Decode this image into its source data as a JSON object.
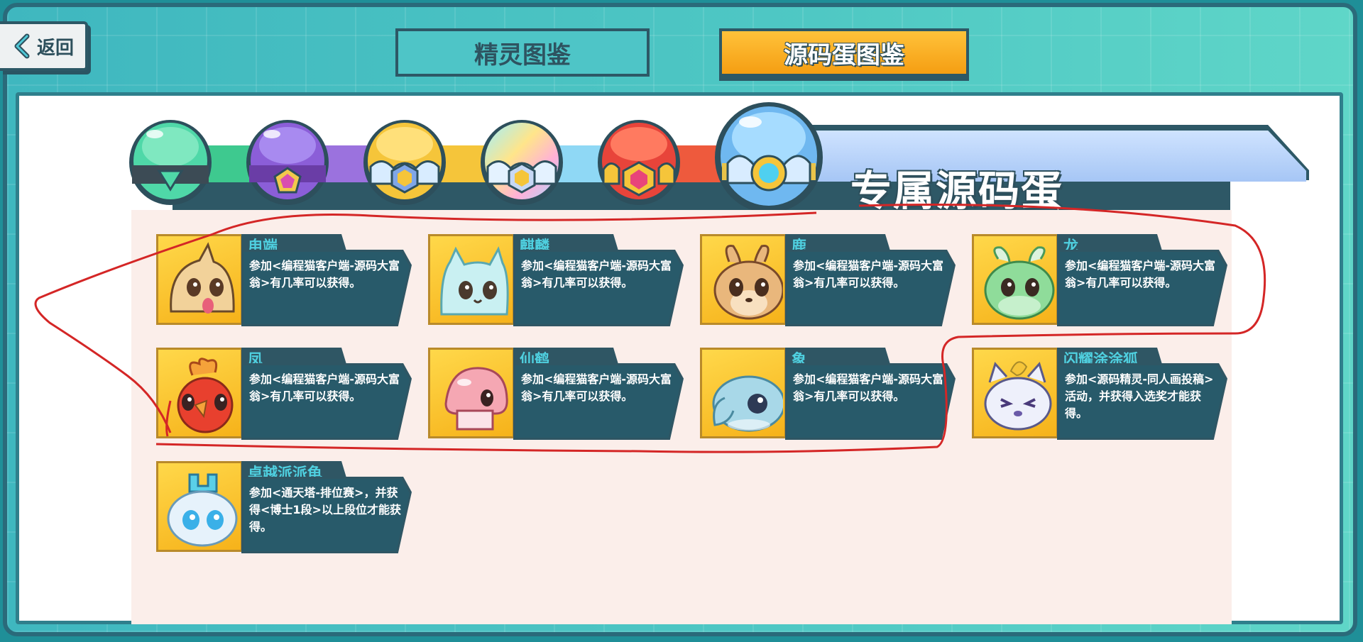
{
  "back_button": {
    "label": "返回"
  },
  "tabs": [
    {
      "label": "精灵图鉴",
      "active": false
    },
    {
      "label": "源码蛋图鉴",
      "active": true
    }
  ],
  "egg_track": {
    "title": "专属源码蛋",
    "eggs": [
      {
        "name": "green-egg",
        "color": "#3ec98f"
      },
      {
        "name": "purple-egg",
        "color": "#8b5ed8"
      },
      {
        "name": "gold-egg",
        "color": "#f5c53a"
      },
      {
        "name": "rainbow-egg",
        "color": "#8fd3ff"
      },
      {
        "name": "red-egg",
        "color": "#e8443a"
      },
      {
        "name": "exclusive-blue-egg",
        "color": "#6fb8f0",
        "selected": true
      }
    ]
  },
  "cards": [
    {
      "name": "甪端",
      "desc": "参加<编程猫客户端-源码大富翁>有几率可以获得。",
      "icon": "luduan-creature-icon",
      "color": "#f2d29a"
    },
    {
      "name": "麒麟",
      "desc": "参加<编程猫客户端-源码大富翁>有几率可以获得。",
      "icon": "qilin-creature-icon",
      "color": "#c9f0f2"
    },
    {
      "name": "鹿",
      "desc": "参加<编程猫客户端-源码大富翁>有几率可以获得。",
      "icon": "deer-creature-icon",
      "color": "#e9b77c"
    },
    {
      "name": "龙",
      "desc": "参加<编程猫客户端-源码大富翁>有几率可以获得。",
      "icon": "dragon-creature-icon",
      "color": "#8fdc9a"
    },
    {
      "name": "凤",
      "desc": "参加<编程猫客户端-源码大富翁>有几率可以获得。",
      "icon": "phoenix-creature-icon",
      "color": "#e8402e"
    },
    {
      "name": "仙鹤",
      "desc": "参加<编程猫客户端-源码大富翁>有几率可以获得。",
      "icon": "crane-creature-icon",
      "color": "#f5a7b3"
    },
    {
      "name": "象",
      "desc": "参加<编程猫客户端-源码大富翁>有几率可以获得。",
      "icon": "elephant-creature-icon",
      "color": "#a8d8e8"
    },
    {
      "name": "闪耀涂涂狐",
      "desc": "参加<源码精灵-同人画投稿>活动，并获得入选奖才能获得。",
      "icon": "fox-creature-icon",
      "color": "#eef0fb"
    },
    {
      "name": "卓越派派龟",
      "desc": "参加<通天塔-排位赛>，并获得<博士1段>以上段位才能获得。",
      "icon": "turtle-creature-icon",
      "color": "#bfe3f5"
    }
  ]
}
